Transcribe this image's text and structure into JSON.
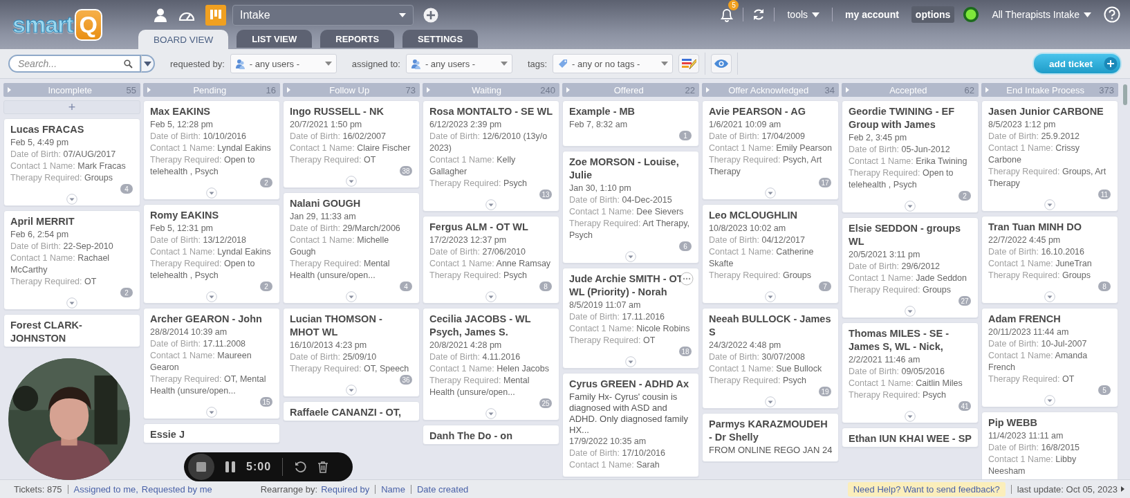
{
  "logo": {
    "text": "smart",
    "mark": "Q"
  },
  "board_select": {
    "value": "Intake"
  },
  "tabs": [
    {
      "label": "BOARD VIEW",
      "selected": true
    },
    {
      "label": "LIST VIEW",
      "selected": false
    },
    {
      "label": "REPORTS",
      "selected": false
    },
    {
      "label": "SETTINGS",
      "selected": false
    }
  ],
  "notifications": {
    "count": "5"
  },
  "top_menu": [
    {
      "label": "tools",
      "kind": "dropdown",
      "selected": false
    },
    {
      "label": "my account",
      "kind": "link",
      "selected": false
    },
    {
      "label": "options",
      "kind": "link",
      "selected": true
    }
  ],
  "user": {
    "name": "All Therapists Intake",
    "online": true
  },
  "toolbar": {
    "search": {
      "placeholder": "Search..."
    },
    "filters": [
      {
        "label": "requested by:",
        "value": "- any users -",
        "kind": "users"
      },
      {
        "label": "assigned to:",
        "value": "- any users -",
        "kind": "users"
      },
      {
        "label": "tags:",
        "value": "- any or no tags -",
        "kind": "tags"
      }
    ],
    "add_button": "add ticket"
  },
  "columns": [
    {
      "name": "Incomplete",
      "count": "55",
      "add_label": "+",
      "cards": [
        {
          "title": "Lucas FRACAS",
          "time": "Feb 5, 4:49 pm",
          "hovered": false,
          "fields": [
            {
              "label": "Date of Birth:",
              "value": "07/AUG/2017"
            },
            {
              "label": "Contact 1 Name:",
              "value": "Mark Fracas"
            },
            {
              "label": "Therapy Required:",
              "value": "Groups"
            }
          ],
          "comments": "4"
        },
        {
          "title": "April MERRIT",
          "time": "Feb 6, 2:54 pm",
          "hovered": false,
          "fields": [
            {
              "label": "Date of Birth:",
              "value": "22-Sep-2010"
            },
            {
              "label": "Contact 1 Name:",
              "value": "Rachael McCarthy"
            },
            {
              "label": "Therapy Required:",
              "value": "OT"
            }
          ],
          "comments": "2"
        },
        {
          "title": "Forest CLARK-JOHNSTON",
          "hovered": false
        }
      ]
    },
    {
      "name": "Pending",
      "count": "16",
      "cards": [
        {
          "title": "Max EAKINS",
          "time": "Feb 5, 12:28 pm",
          "hovered": false,
          "fields": [
            {
              "label": "Date of Birth:",
              "value": "10/10/2016"
            },
            {
              "label": "Contact 1 Name:",
              "value": "Lyndal Eakins"
            },
            {
              "label": "Therapy Required:",
              "value": "Open to telehealth , Psych"
            }
          ],
          "comments": "2"
        },
        {
          "title": "Romy EAKINS",
          "time": "Feb 5, 12:31 pm",
          "hovered": false,
          "fields": [
            {
              "label": "Date of Birth:",
              "value": "13/12/2018"
            },
            {
              "label": "Contact 1 Name:",
              "value": "Lyndal Eakins"
            },
            {
              "label": "Therapy Required:",
              "value": "Open to telehealth , Psych"
            }
          ],
          "comments": "2"
        },
        {
          "title": "Archer GEARON - John",
          "time": "28/8/2014 10:39 am",
          "hovered": false,
          "fields": [
            {
              "label": "Date of Birth:",
              "value": "17.11.2008"
            },
            {
              "label": "Contact 1 Name:",
              "value": "Maureen Gearon"
            },
            {
              "label": "Therapy Required:",
              "value": "OT, Mental Health (unsure/open..."
            }
          ],
          "comments": "15"
        },
        {
          "title": "Essie J",
          "hovered": false
        }
      ]
    },
    {
      "name": "Follow Up",
      "count": "73",
      "cards": [
        {
          "title": "Ingo RUSSELL - NK",
          "time": "20/7/2021 1:50 pm",
          "hovered": false,
          "fields": [
            {
              "label": "Date of Birth:",
              "value": "16/02/2007"
            },
            {
              "label": "Contact 1 Name:",
              "value": "Claire Fischer"
            },
            {
              "label": "Therapy Required:",
              "value": "OT"
            }
          ],
          "comments": "38"
        },
        {
          "title": "Nalani GOUGH",
          "time": "Jan 29, 11:33 am",
          "hovered": false,
          "fields": [
            {
              "label": "Date of Birth:",
              "value": "29/March/2006"
            },
            {
              "label": "Contact 1 Name:",
              "value": "Michelle Gough"
            },
            {
              "label": "Therapy Required:",
              "value": "Mental Health (unsure/open..."
            }
          ],
          "comments": "4"
        },
        {
          "title": "Lucian THOMSON - MHOT WL",
          "time": "16/10/2013 4:23 pm",
          "hovered": false,
          "fields": [
            {
              "label": "Date of Birth:",
              "value": "25/09/10"
            },
            {
              "label": "Therapy Required:",
              "value": "OT, Speech"
            }
          ],
          "comments": "36"
        },
        {
          "title": "Raffaele CANANZI - OT,",
          "hovered": false
        }
      ]
    },
    {
      "name": "Waiting",
      "count": "240",
      "cards": [
        {
          "title": "Rosa MONTALTO - SE WL",
          "time": "6/12/2023 2:39 pm",
          "hovered": false,
          "fields": [
            {
              "label": "Date of Birth:",
              "value": "12/6/2010 (13y/o 2023)"
            },
            {
              "label": "Contact 1 Name:",
              "value": "Kelly Gallagher"
            },
            {
              "label": "Therapy Required:",
              "value": "Psych"
            }
          ],
          "comments": "13"
        },
        {
          "title": "Fergus ALM - OT WL",
          "time": "17/2/2023 12:37 pm",
          "hovered": false,
          "fields": [
            {
              "label": "Date of Birth:",
              "value": "27/06/2010"
            },
            {
              "label": "Contact 1 Name:",
              "value": "Anne Ramsay"
            },
            {
              "label": "Therapy Required:",
              "value": "Psych"
            }
          ],
          "comments": "8"
        },
        {
          "title": "Cecilia JACOBS - WL Psych, James S.",
          "time": "20/8/2021 4:28 pm",
          "hovered": false,
          "fields": [
            {
              "label": "Date of Birth:",
              "value": "4.11.2016"
            },
            {
              "label": "Contact 1 Name:",
              "value": "Helen Jacobs"
            },
            {
              "label": "Therapy Required:",
              "value": "Mental Health (unsure/open..."
            }
          ],
          "comments": "25"
        },
        {
          "title": "Danh The Do - on",
          "hovered": false
        }
      ]
    },
    {
      "name": "Offered",
      "count": "22",
      "cards": [
        {
          "title": "Example - MB",
          "time": "Feb 7, 8:32 am",
          "hovered": false,
          "comments": "1"
        },
        {
          "title": "Zoe MORSON - Louise, Julie",
          "time": "Jan 30, 1:10 pm",
          "hovered": false,
          "fields": [
            {
              "label": "Date of Birth:",
              "value": "04-Dec-2015"
            },
            {
              "label": "Contact 1 Name:",
              "value": "Dee Sievers"
            },
            {
              "label": "Therapy Required:",
              "value": "Art Therapy, Psych"
            }
          ],
          "comments": "6"
        },
        {
          "title": "Jude Archie SMITH - OT WL (Priority) - Norah",
          "time": "8/5/2019 11:07 am",
          "hovered": true,
          "fields": [
            {
              "label": "Date of Birth:",
              "value": "17.11.2016"
            },
            {
              "label": "Contact 1 Name:",
              "value": "Nicole Robins"
            },
            {
              "label": "Therapy Required:",
              "value": "OT"
            }
          ],
          "comments": "18"
        },
        {
          "title": "Cyrus GREEN - ADHD Ax",
          "note": "Family Hx- Cyrus' cousin is diagnosed with ASD and ADHD. Only diagnosed family HX...",
          "time": "17/9/2022 10:35 am",
          "hovered": false,
          "fields": [
            {
              "label": "Date of Birth:",
              "value": "17/10/2016"
            },
            {
              "label": "Contact 1 Name:",
              "value": "Sarah"
            }
          ]
        }
      ]
    },
    {
      "name": "Offer Acknowledged",
      "count": "34",
      "cards": [
        {
          "title": "Avie PEARSON - AG",
          "time": "1/6/2021 10:09 am",
          "hovered": false,
          "fields": [
            {
              "label": "Date of Birth:",
              "value": "17/04/2009"
            },
            {
              "label": "Contact 1 Name:",
              "value": "Emily Pearson"
            },
            {
              "label": "Therapy Required:",
              "value": "Psych, Art Therapy"
            }
          ],
          "comments": "17"
        },
        {
          "title": "Leo MCLOUGHLIN",
          "time": "10/8/2023 10:02 am",
          "hovered": false,
          "fields": [
            {
              "label": "Date of Birth:",
              "value": "04/12/2017"
            },
            {
              "label": "Contact 1 Name:",
              "value": "Catherine Skafte"
            },
            {
              "label": "Therapy Required:",
              "value": "Groups"
            }
          ],
          "comments": "7"
        },
        {
          "title": "Neeah BULLOCK - James S",
          "time": "24/3/2022 4:48 pm",
          "hovered": false,
          "fields": [
            {
              "label": "Date of Birth:",
              "value": "30/07/2008"
            },
            {
              "label": "Contact 1 Name:",
              "value": "Sue Bullock"
            },
            {
              "label": "Therapy Required:",
              "value": "Psych"
            }
          ],
          "comments": "19"
        },
        {
          "title": "Parmys KARAZMOUDEH - Dr Shelly",
          "note": "FROM ONLINE REGO JAN 24",
          "hovered": false
        }
      ]
    },
    {
      "name": "Accepted",
      "count": "62",
      "cards": [
        {
          "title": "Geordie TWINING - EF Group with James",
          "time": "Feb 2, 3:45 pm",
          "hovered": false,
          "fields": [
            {
              "label": "Date of Birth:",
              "value": "05-Jun-2012"
            },
            {
              "label": "Contact 1 Name:",
              "value": "Erika Twining"
            },
            {
              "label": "Therapy Required:",
              "value": "Open to telehealth , Psych"
            }
          ],
          "comments": "2"
        },
        {
          "title": "Elsie SEDDON - groups WL",
          "time": "20/5/2021 3:11 pm",
          "hovered": false,
          "fields": [
            {
              "label": "Date of Birth:",
              "value": "29/6/2012"
            },
            {
              "label": "Contact 1 Name:",
              "value": "Jade Seddon"
            },
            {
              "label": "Therapy Required:",
              "value": "Groups"
            }
          ],
          "comments": "27"
        },
        {
          "title": "Thomas MILES - SE - James S, WL - Nick,",
          "time": "2/2/2021 11:46 am",
          "hovered": false,
          "fields": [
            {
              "label": "Date of Birth:",
              "value": "09/05/2016"
            },
            {
              "label": "Contact 1 Name:",
              "value": "Caitlin Miles"
            },
            {
              "label": "Therapy Required:",
              "value": "Psych"
            }
          ],
          "comments": "41"
        },
        {
          "title": "Ethan IUN KHAI WEE - SP",
          "hovered": false
        }
      ]
    },
    {
      "name": "End Intake Process",
      "count": "373",
      "cards": [
        {
          "title": "Jasen Junior CARBONE",
          "time": "8/5/2023 1:12 pm",
          "hovered": false,
          "fields": [
            {
              "label": "Date of Birth:",
              "value": "25.9.2012"
            },
            {
              "label": "Contact 1 Name:",
              "value": "Crissy Carbone"
            },
            {
              "label": "Therapy Required:",
              "value": "Groups, Art Therapy"
            }
          ],
          "comments": "11"
        },
        {
          "title": "Tran Tuan MINH DO",
          "time": "22/7/2022 4:45 pm",
          "hovered": false,
          "fields": [
            {
              "label": "Date of Birth:",
              "value": "16.10.2016"
            },
            {
              "label": "Contact 1 Name:",
              "value": "JuneTran"
            },
            {
              "label": "Therapy Required:",
              "value": "Groups"
            }
          ],
          "comments": "8"
        },
        {
          "title": "Adam FRENCH",
          "time": "20/11/2023 11:44 am",
          "hovered": false,
          "fields": [
            {
              "label": "Date of Birth:",
              "value": "10-Jul-2007"
            },
            {
              "label": "Contact 1 Name:",
              "value": "Amanda French"
            },
            {
              "label": "Therapy Required:",
              "value": "OT"
            }
          ],
          "comments": "5"
        },
        {
          "title": "Pip WEBB",
          "time": "11/4/2023 11:11 am",
          "hovered": false,
          "fields": [
            {
              "label": "Date of Birth:",
              "value": "16/8/2015"
            },
            {
              "label": "Contact 1 Name:",
              "value": "Libby Neesham"
            }
          ]
        }
      ]
    }
  ],
  "status_bar": {
    "tickets": "Tickets: 875",
    "views": [
      "Assigned to me,",
      "Requested by me"
    ],
    "rearrange_label": "Rearrange by:",
    "rearrange": [
      "Required by",
      "Name",
      "Date created"
    ],
    "help": "Need Help? Want to send feedback?",
    "last_update": "last update: Oct 05, 2023"
  },
  "recorder": {
    "time": "5:00"
  }
}
